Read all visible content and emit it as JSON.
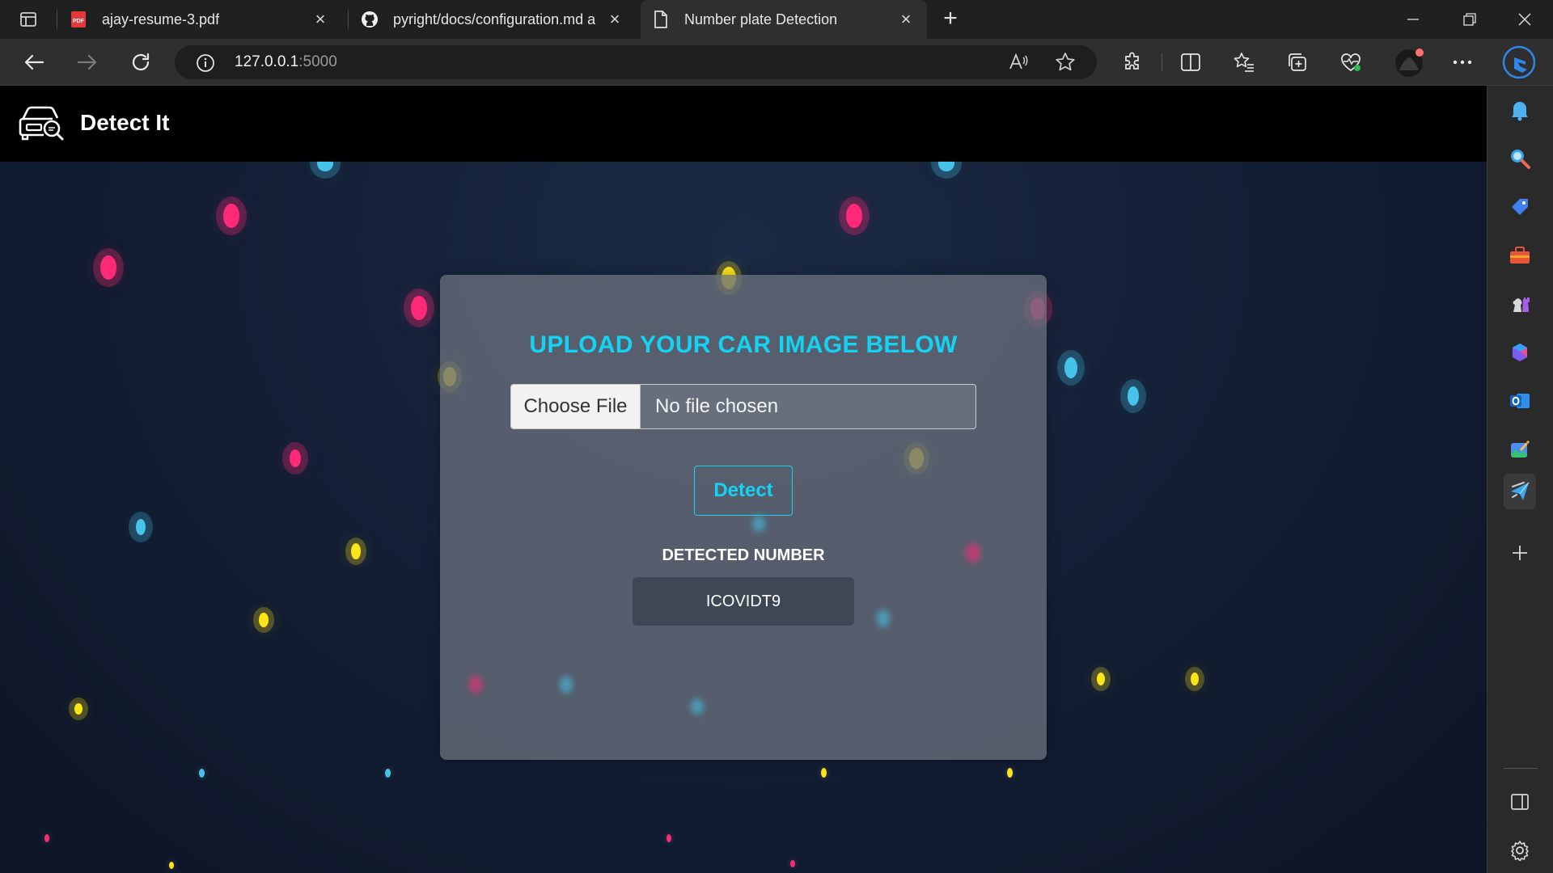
{
  "browser": {
    "tabs": [
      {
        "title": "ajay-resume-3.pdf",
        "icon": "pdf-icon",
        "active": false
      },
      {
        "title": "pyright/docs/configuration.md a",
        "icon": "github-icon",
        "active": false
      },
      {
        "title": "Number plate Detection",
        "icon": "page-icon",
        "active": true
      }
    ],
    "address": {
      "host": "127.0.0.1",
      "port": ":5000"
    }
  },
  "navbar": {
    "brand": "Detect It"
  },
  "form": {
    "heading": "UPLOAD YOUR CAR IMAGE BELOW",
    "choose_file_label": "Choose File",
    "file_status": "No file chosen",
    "detect_label": "Detect"
  },
  "result": {
    "label": "DETECTED NUMBER",
    "value": "ICOVIDT9"
  },
  "colors": {
    "accent": "#14d3f2",
    "navbar": "#000000",
    "card": "#69707c"
  }
}
